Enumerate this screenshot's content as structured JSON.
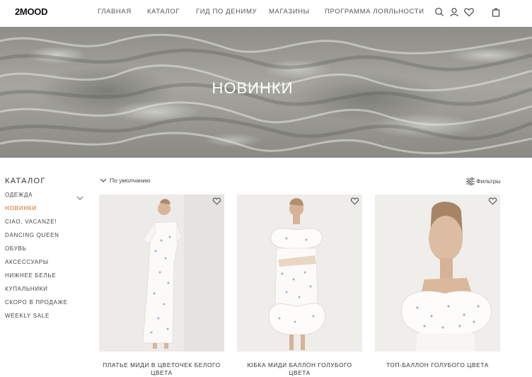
{
  "header": {
    "logo": "2MOOD",
    "nav": [
      "ГЛАВНАЯ",
      "КАТАЛОГ",
      "ГИД ПО ДЕНИМУ",
      "МАГАЗИНЫ",
      "ПРОГРАММА ЛОЯЛЬНОСТИ"
    ],
    "icons": [
      "search-icon",
      "user-icon",
      "heart-icon",
      "bag-icon"
    ]
  },
  "banner": {
    "title": "НОВИНКИ"
  },
  "sidebar": {
    "title": "КАТАЛОГ",
    "items": [
      {
        "label": "ОДЕЖДА"
      },
      {
        "label": "НОВИНКИ"
      },
      {
        "label": "CIAO, VACANZE!"
      },
      {
        "label": "DANCING QUEEN"
      },
      {
        "label": "ОБУВЬ"
      },
      {
        "label": "АКСЕССУАРЫ"
      },
      {
        "label": "НИЖНЕЕ БЕЛЬЕ"
      },
      {
        "label": "КУПАЛЬНИКИ"
      },
      {
        "label": "СКОРО В ПРОДАЖЕ"
      },
      {
        "label": "WEEKLY SALE"
      }
    ],
    "active_index": 1,
    "active_color": "#e0925a"
  },
  "toolbar": {
    "sort_label": "По умолчанию",
    "filters_label": "Фильтры"
  },
  "products": [
    {
      "title": "ПЛАТЬЕ МИДИ В ЦВЕТОЧЕК БЕЛОГО ЦВЕТА"
    },
    {
      "title": "ЮБКА МИДИ БАЛЛОН ГОЛУБОГО ЦВЕТА"
    },
    {
      "title": "ТОП-БАЛЛОН ГОЛУБОГО ЦВЕТА"
    }
  ]
}
